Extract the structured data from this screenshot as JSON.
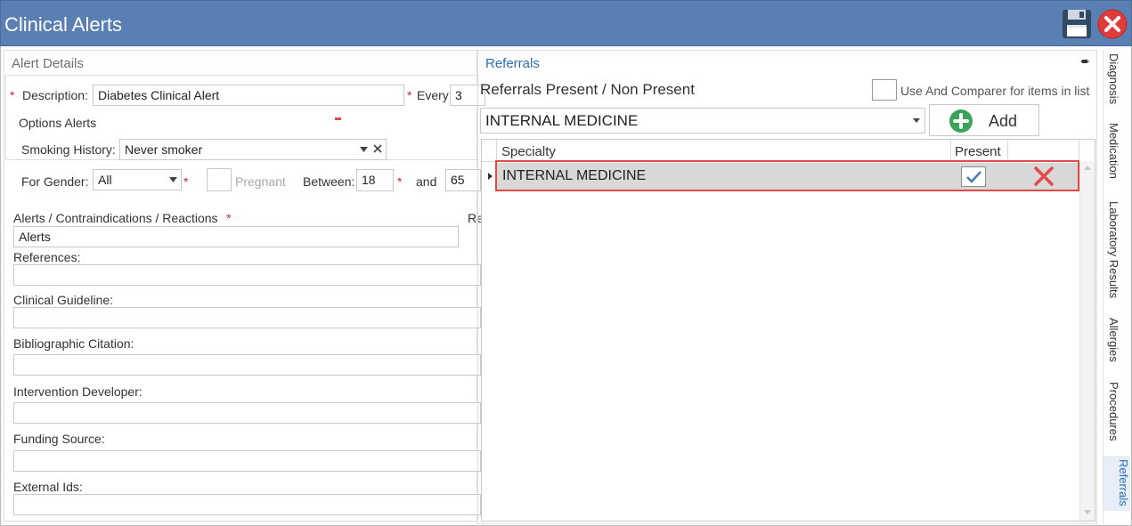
{
  "window": {
    "title": "Clinical Alerts"
  },
  "left": {
    "group_title": "Alert Details",
    "description_label": "Description:",
    "description_value": "Diabetes Clinical Alert",
    "every_label": "Every:",
    "every_value": "3",
    "options_title": "Options Alerts",
    "smoking_label": "Smoking History:",
    "smoking_value": "Never smoker",
    "gender_label": "For Gender:",
    "gender_value": "All",
    "pregnant_label": "Pregnant",
    "between_label": "Between:",
    "between_from": "18",
    "and_label": "and",
    "between_to": "65",
    "alerts_label": "Alerts / Contraindications / Reactions",
    "alerts_cut_label": "Re",
    "alerts_value": "Alerts",
    "references_label": "References:",
    "clinical_guideline_label": "Clinical Guideline:",
    "bibliographic_label": "Bibliographic Citation:",
    "intervention_label": "Intervention Developer:",
    "funding_label": "Funding Source:",
    "external_label": "External Ids:"
  },
  "right": {
    "title": "Referrals",
    "subtitle": "Referrals Present / Non Present",
    "comparer_label": "Use And Comparer for items in list",
    "specialty_select": "INTERNAL MEDICINE",
    "add_label": "Add",
    "grid": {
      "columns": [
        "Specialty",
        "Present"
      ],
      "rows": [
        {
          "specialty": "INTERNAL MEDICINE",
          "present": true
        }
      ]
    }
  },
  "tabs": [
    "Diagnosis",
    "Medication",
    "Laboratory Results",
    "Allergies",
    "Procedures",
    "Referrals"
  ],
  "colors": {
    "titlebar": "#5a7fb3",
    "accent": "#2a6ebb",
    "required": "#d7262e",
    "highlight": "#e04a4a"
  }
}
